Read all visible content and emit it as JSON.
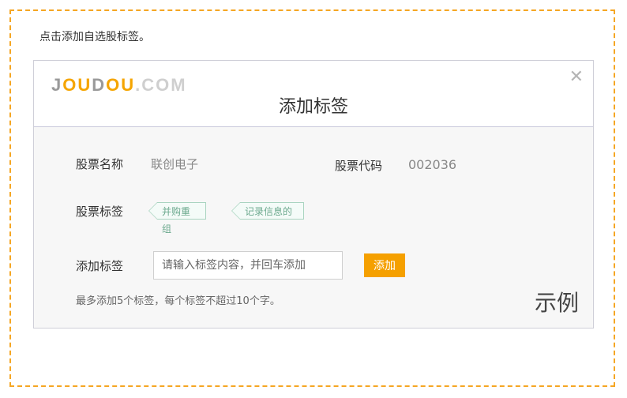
{
  "hint": "点击添加自选股标签。",
  "dialog": {
    "logo": {
      "part1": "J",
      "part2": "OU",
      "part3": "D",
      "part4": "OU",
      "part5": ".COM"
    },
    "title": "添加标签",
    "close_icon": "close-icon",
    "stock_name_label": "股票名称",
    "stock_name_value": "联创电子",
    "stock_code_label": "股票代码",
    "stock_code_value": "002036",
    "stock_tags_label": "股票标签",
    "tags": [
      "并购重组",
      "记录信息的"
    ],
    "add_tag_label": "添加标签",
    "input_placeholder": "请输入标签内容，并回车添加",
    "add_button": "添加",
    "note": "最多添加5个标签，每个标签不超过10个字。",
    "example": "示例"
  },
  "colors": {
    "accent": "#f5a000",
    "dashed_border": "#f5a623",
    "tag_green": "#6ca98e"
  }
}
